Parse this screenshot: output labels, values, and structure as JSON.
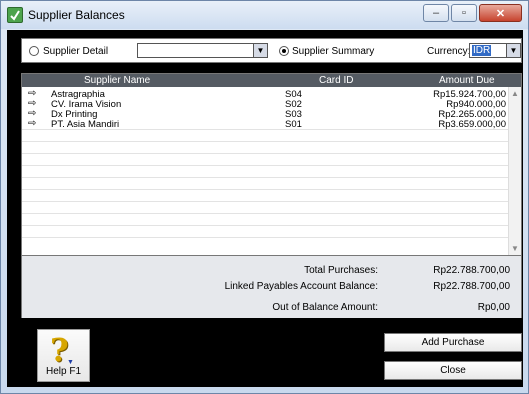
{
  "window": {
    "title": "Supplier Balances",
    "controls": [
      "–",
      "▫",
      "✕"
    ]
  },
  "options": {
    "supplier_detail_label": "Supplier Detail",
    "supplier_detail_selected": false,
    "supplier_detail_value": "",
    "supplier_summary_label": "Supplier Summary",
    "supplier_summary_selected": true,
    "currency_label": "Currency:",
    "currency_value": "IDR"
  },
  "table": {
    "columns": [
      "Supplier Name",
      "Card ID",
      "Amount Due"
    ],
    "rows": [
      {
        "name": "Astragraphia",
        "card_id": "S04",
        "amount": "Rp15.924.700,00"
      },
      {
        "name": "CV. Irama Vision",
        "card_id": "S02",
        "amount": "Rp940.000,00"
      },
      {
        "name": "Dx Printing",
        "card_id": "S03",
        "amount": "Rp2.265.000,00"
      },
      {
        "name": "PT. Asia Mandiri",
        "card_id": "S01",
        "amount": "Rp3.659.000,00"
      }
    ]
  },
  "totals": {
    "total_purchases_label": "Total Purchases:",
    "total_purchases_value": "Rp22.788.700,00",
    "linked_label": "Linked Payables Account Balance:",
    "linked_value": "Rp22.788.700,00",
    "out_of_balance_label": "Out of Balance Amount:",
    "out_of_balance_value": "Rp0,00"
  },
  "buttons": {
    "help_label": "Help F1",
    "add_purchase": "Add Purchase",
    "close": "Close"
  },
  "colors": {
    "header_bg": "#555b63",
    "frame_bg": "#000000",
    "selection": "#316ac5"
  }
}
